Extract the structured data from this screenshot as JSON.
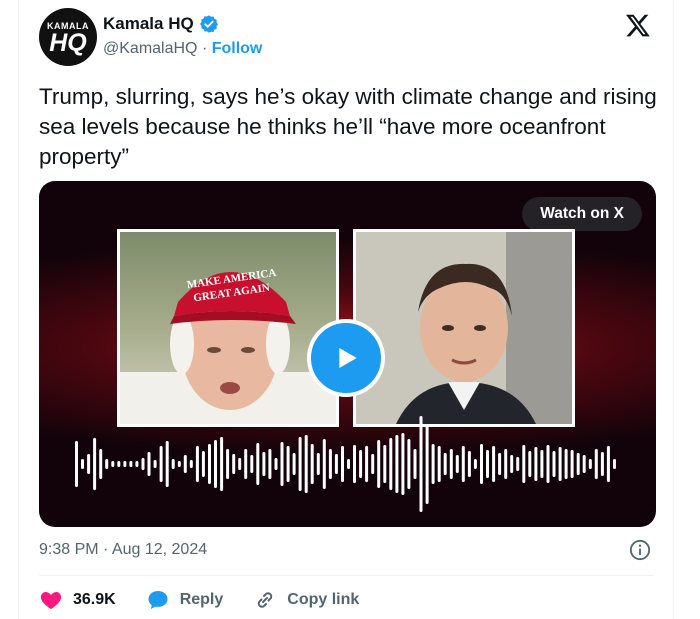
{
  "author": {
    "name": "Kamala HQ",
    "handle": "@KamalaHQ",
    "separator": " · ",
    "follow_label": "Follow",
    "avatar_text_top": "KAMALA",
    "avatar_text_bottom": "HQ",
    "verified_icon": "verified-badge-icon"
  },
  "platform_icon": "x-logo-icon",
  "tweet": {
    "text": "Trump, slurring, says he’s okay with climate change and rising sea levels because he thinks he’ll “have more oceanfront property”"
  },
  "media": {
    "watch_label": "Watch on X",
    "left_photo_cap_text": "MAKE AMERICA GREAT AGAIN",
    "play_icon": "play-icon"
  },
  "meta": {
    "timestamp": "9:38 PM · Aug 12, 2024",
    "info_icon": "info-icon"
  },
  "actions": {
    "likes_count": "36.9K",
    "reply_label": "Reply",
    "copy_link_label": "Copy link"
  },
  "colors": {
    "accent": "#1d9bf0",
    "like": "#f91880",
    "text": "#0f1419",
    "muted": "#536471"
  }
}
